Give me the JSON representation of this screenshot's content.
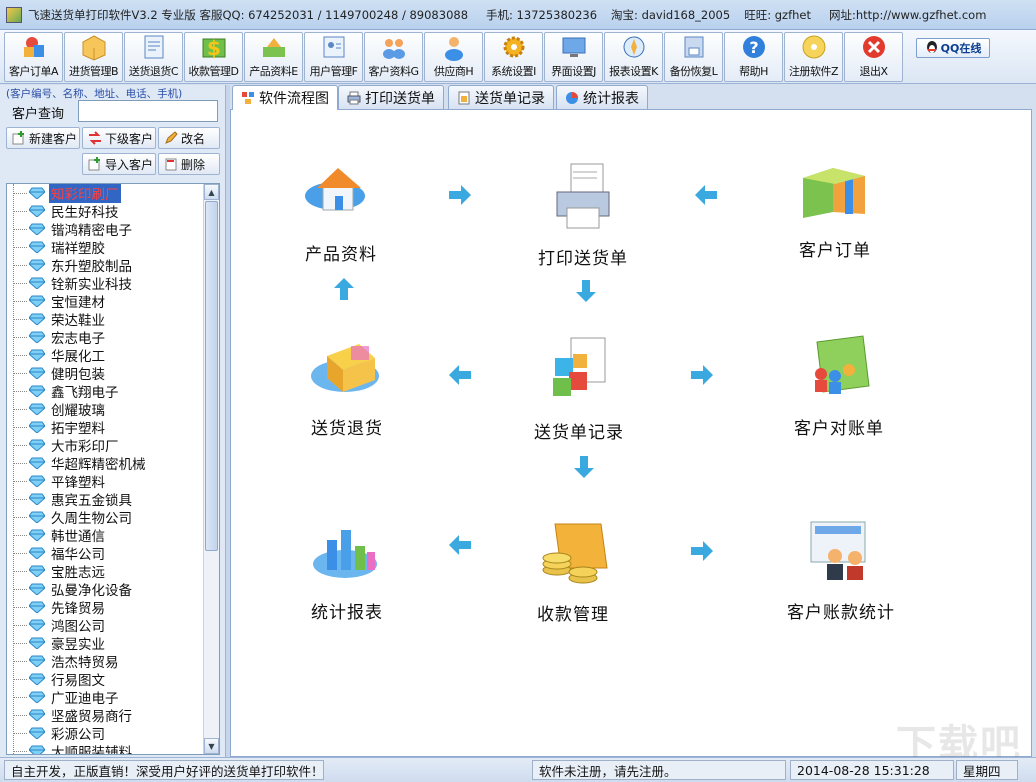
{
  "window": {
    "title": "飞速送货单打印软件V3.2 专业版 客服QQ: 674252031 / 1149700248 / 89083088",
    "phone": "手机: 13725380236",
    "taobao": "淘宝: david168_2005",
    "wangwang": "旺旺: gzfhet",
    "website": "网址:http://www.gzfhet.com"
  },
  "toolbar": {
    "buttons": [
      {
        "label": "客户订单A",
        "icon": "customer-order-icon"
      },
      {
        "label": "进货管理B",
        "icon": "purchase-icon"
      },
      {
        "label": "送货退货C",
        "icon": "delivery-return-icon"
      },
      {
        "label": "收款管理D",
        "icon": "payment-icon"
      },
      {
        "label": "产品资料E",
        "icon": "product-icon"
      },
      {
        "label": "用户管理F",
        "icon": "user-management-icon"
      },
      {
        "label": "客户资料G",
        "icon": "customer-info-icon"
      },
      {
        "label": "供应商H",
        "icon": "supplier-icon"
      },
      {
        "label": "系统设置I",
        "icon": "settings-gear-icon"
      },
      {
        "label": "界面设置J",
        "icon": "monitor-icon"
      },
      {
        "label": "报表设置K",
        "icon": "report-settings-icon"
      },
      {
        "label": "备份恢复L",
        "icon": "backup-icon"
      },
      {
        "label": "帮助H",
        "icon": "help-icon"
      },
      {
        "label": "注册软件Z",
        "icon": "register-cd-icon"
      },
      {
        "label": "退出X",
        "icon": "exit-icon"
      }
    ],
    "qq_online": "QQ在线"
  },
  "left": {
    "hint": "(客户编号、名称、地址、电话、手机)",
    "search_label": "客户查询",
    "search_value": "",
    "buttons": {
      "new_customer": "新建客户",
      "sub_customer": "下级客户",
      "rename": "改名",
      "import_customer": "导入客户",
      "delete": "删除"
    },
    "customers": [
      "知彩印刷厂",
      "民生好科技",
      "锴鸿精密电子",
      "瑞祥塑胶",
      "东升塑胶制品",
      "铨新实业科技",
      "宝恒建材",
      "荣达鞋业",
      "宏志电子",
      "华展化工",
      "健明包装",
      "鑫飞翔电子",
      "创耀玻璃",
      "拓宇塑料",
      "大市彩印厂",
      "华超辉精密机械",
      "平锋塑料",
      "惠宾五金锁具",
      "久周生物公司",
      "韩世通信",
      "福华公司",
      "宝胜志远",
      "弘曼净化设备",
      "先锋贸易",
      "鸿图公司",
      "豪昱实业",
      "浩杰特贸易",
      "行易图文",
      "广亚迪电子",
      "坚盛贸易商行",
      "彩源公司",
      "大顺服装辅料"
    ],
    "selected_index": 0
  },
  "tabs": [
    {
      "label": "软件流程图",
      "active": true
    },
    {
      "label": "打印送货单",
      "active": false
    },
    {
      "label": "送货单记录",
      "active": false
    },
    {
      "label": "统计报表",
      "active": false
    }
  ],
  "flow": {
    "product_info": "产品资料",
    "print_delivery": "打印送货单",
    "customer_order": "客户订单",
    "delivery_return": "送货退货",
    "delivery_records": "送货单记录",
    "customer_statement": "客户对账单",
    "statistics_report": "统计报表",
    "payment_management": "收款管理",
    "customer_account_stats": "客户账款统计"
  },
  "status": {
    "left": "自主开发，正版直销！深受用户好评的送货单打印软件！",
    "middle": "软件未注册，请先注册。",
    "datetime": "2014-08-28 15:31:28",
    "weekday": "星期四"
  },
  "watermark": "下载吧",
  "colors": {
    "arrow": "#39a9e0",
    "selection": "#3166c5",
    "hint": "#2a4ea8"
  }
}
